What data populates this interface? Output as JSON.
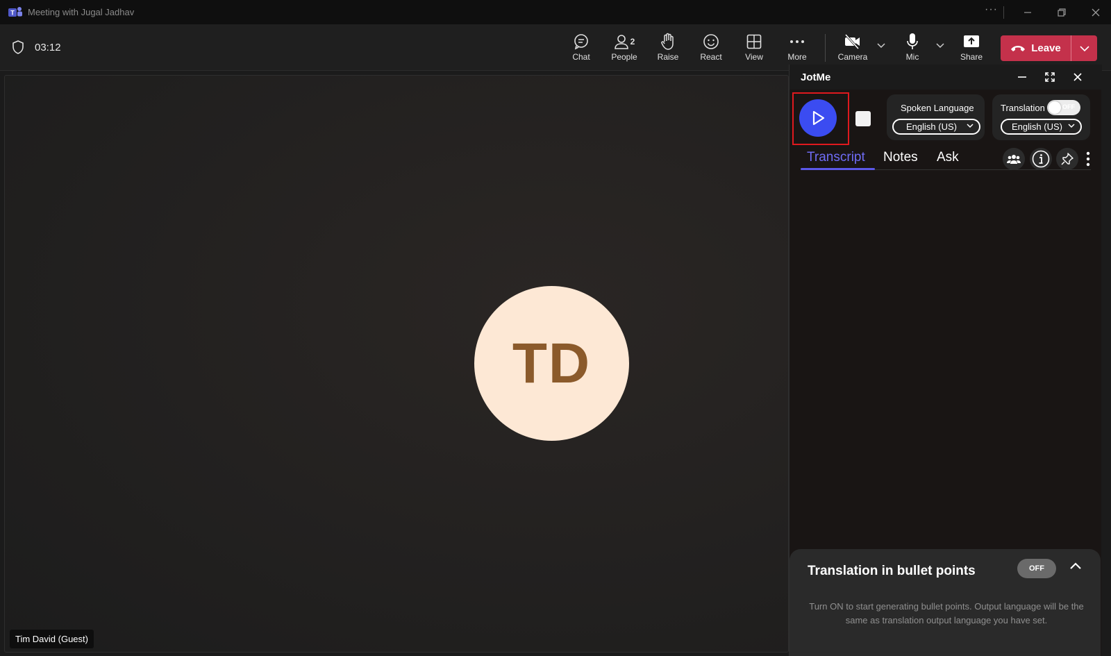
{
  "titlebar": {
    "title": "Meeting with Jugal Jadhav",
    "more": "···"
  },
  "toolbar": {
    "timer": "03:12",
    "chat": "Chat",
    "people": "People",
    "people_count": "2",
    "raise": "Raise",
    "react": "React",
    "view": "View",
    "more": "More",
    "camera": "Camera",
    "mic": "Mic",
    "share": "Share",
    "leave": "Leave"
  },
  "stage": {
    "avatar_initials": "TD",
    "participant_name": "Tim David (Guest)"
  },
  "jotme": {
    "title": "JotMe",
    "spoken_language_label": "Spoken Language",
    "spoken_language_value": "English (US)",
    "translation_label": "Translation",
    "translation_toggle": "OFF",
    "translation_value": "English (US)",
    "tabs": [
      "Transcript",
      "Notes",
      "Ask"
    ],
    "active_tab": "Transcript",
    "bullet_card": {
      "title": "Translation in bullet points",
      "toggle": "OFF",
      "description": "Turn ON to start generating bullet points. Output language will be the same as translation output language you have set."
    }
  },
  "colors": {
    "leave_red": "#c4314b",
    "play_blue": "#3b4cf1",
    "highlight_red": "#e0191e",
    "active_tab": "#6f6cf5",
    "avatar_bg": "#fde8d5",
    "avatar_text": "#8b5a2b"
  }
}
